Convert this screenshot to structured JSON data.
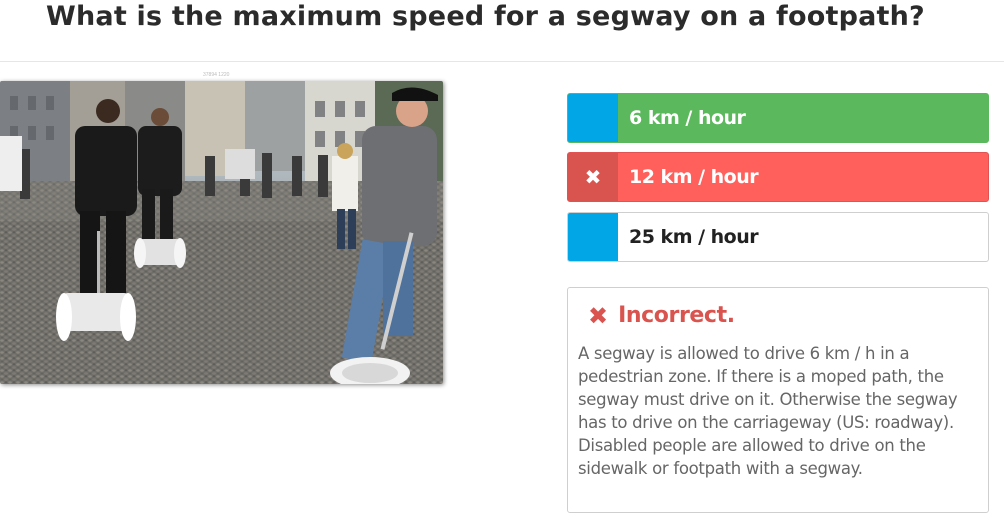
{
  "question": {
    "title": "What is the maximum speed for a segway on a footpath?"
  },
  "photo": {
    "description_icon": "segway-photo",
    "credit": "37894 1220"
  },
  "answers": [
    {
      "label": "6 km / hour",
      "state": "correct",
      "marker": ""
    },
    {
      "label": "12 km / hour",
      "state": "wrong",
      "marker": "✖"
    },
    {
      "label": "25 km / hour",
      "state": "neutral",
      "marker": ""
    }
  ],
  "feedback": {
    "icon": "x-icon",
    "icon_glyph": "✖",
    "title": "Incorrect.",
    "text": "A segway is allowed to drive 6 km / h in a pedestrian zone. If there is a moped path, the segway must drive on it. Otherwise the segway has to drive on the carriageway (US: roadway). Disabled people are allowed to drive on the sidewalk or footpath with a segway."
  },
  "colors": {
    "correct": "#5cb85c",
    "wrong": "#ff605c",
    "wrong_marker": "#d9534f",
    "marker_blue": "#00a6e6",
    "feedback_red": "#d9534f"
  }
}
